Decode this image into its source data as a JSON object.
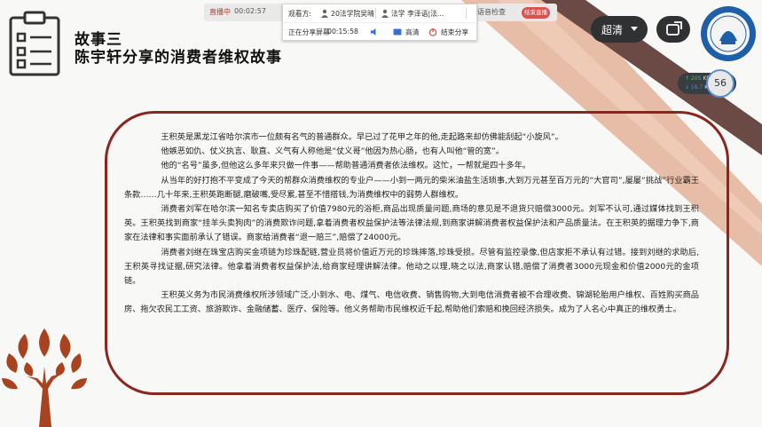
{
  "toolbar": {
    "live_label": "直播中",
    "live_time": "00:02:57",
    "viewers_label": "观看方:",
    "viewers": "20法学院吴晴",
    "presenter": "法学 李泽语|法...",
    "mic_label": "语音检查",
    "end_button": "结束直播"
  },
  "share": {
    "status": "正在分享屏幕",
    "elapsed": "00:15:58",
    "hd_label": "高清",
    "stop_label": "结束分享"
  },
  "quality": {
    "label": "超清"
  },
  "network": {
    "up": "↑ 20S",
    "up_unit": "KB/s",
    "down": "↓ 16.7",
    "down_unit": "KB/s",
    "cpu": "56"
  },
  "slide": {
    "title_line1": "故事三",
    "title_line2": "陈宇轩分享的消费者维权故事",
    "paragraphs": [
      "王积英是黑龙江省哈尔滨市一位颇有名气的普通群众。早已过了花甲之年的他,走起路来却仿佛能刮起“小旋风”。",
      "他嫉恶如仇、仗义执言、耿直、义气有人称他是“仗义哥”他因为热心肠，也有人叫他“管的宽”。",
      "他的“名号”虽多,但他这么多年来只做一件事——帮助普通消费者依法维权。这忙，一帮就是四十多年。",
      "从当年的好打抱不平变成了今天的帮群众消费维权的专业户——小到一两元的柴米油盐生活琐事,大到万元甚至百万元的“大官司”,屡屡“挑战”行业霸王条款……几十年来,王积英跑断腿,磨破嘴,受尽累,甚至不惜搭钱,为消费维权中的弱势人群维权。",
      "消费者刘军在哈尔滨一知名专卖店购买了价值7980元的浴柜,商品出现质量问题,商场的意见是不退货只赔偿3000元。刘军不认可,通过媒体找到王积英。王积英找到商家“挂羊头卖狗肉”的消费欺诈问题,拿着消费者权益保护法等法律法规,到商家讲解消费者权益保护法和产品质量法。在王积英的据理力争下,商家在法律和事实面前承认了错误。商家给消费者“退一赔三”,赔偿了24000元。",
      "消费者刘继在珠宝店购买金项链为珍珠配链,营业员将价值近万元的珍珠摔落,珍珠受损。尽管有监控录像,但店家拒不承认有过错。接到刘继的求助后,王积英寻找证据,研究法律。他拿着消费者权益保护法,给商家经理讲解法律。他动之以理,晓之以法,商家认错,赔偿了消费者3000元现金和价值2000元的金项链。",
      "王积英义务为市民消费维权所涉领域广泛,小到水、电、煤气、电信收费、销售购物,大到电信消费者被不合理收费、锦湖轮胎用户维权、百姓购买商品房、拖欠农民工工资、旅游欺诈、金融储蓄、医疗、保险等。他义务帮助市民维权近千起,帮助他们索赔和挽回经济损失。成为了人名心中真正的维权勇士。"
    ]
  },
  "colors": {
    "accent": "#8b2520",
    "frame": "#8b2520",
    "tree": "#a8421f",
    "deco_dark": "#6b4a45",
    "deco_light": "#e3aa8c"
  }
}
